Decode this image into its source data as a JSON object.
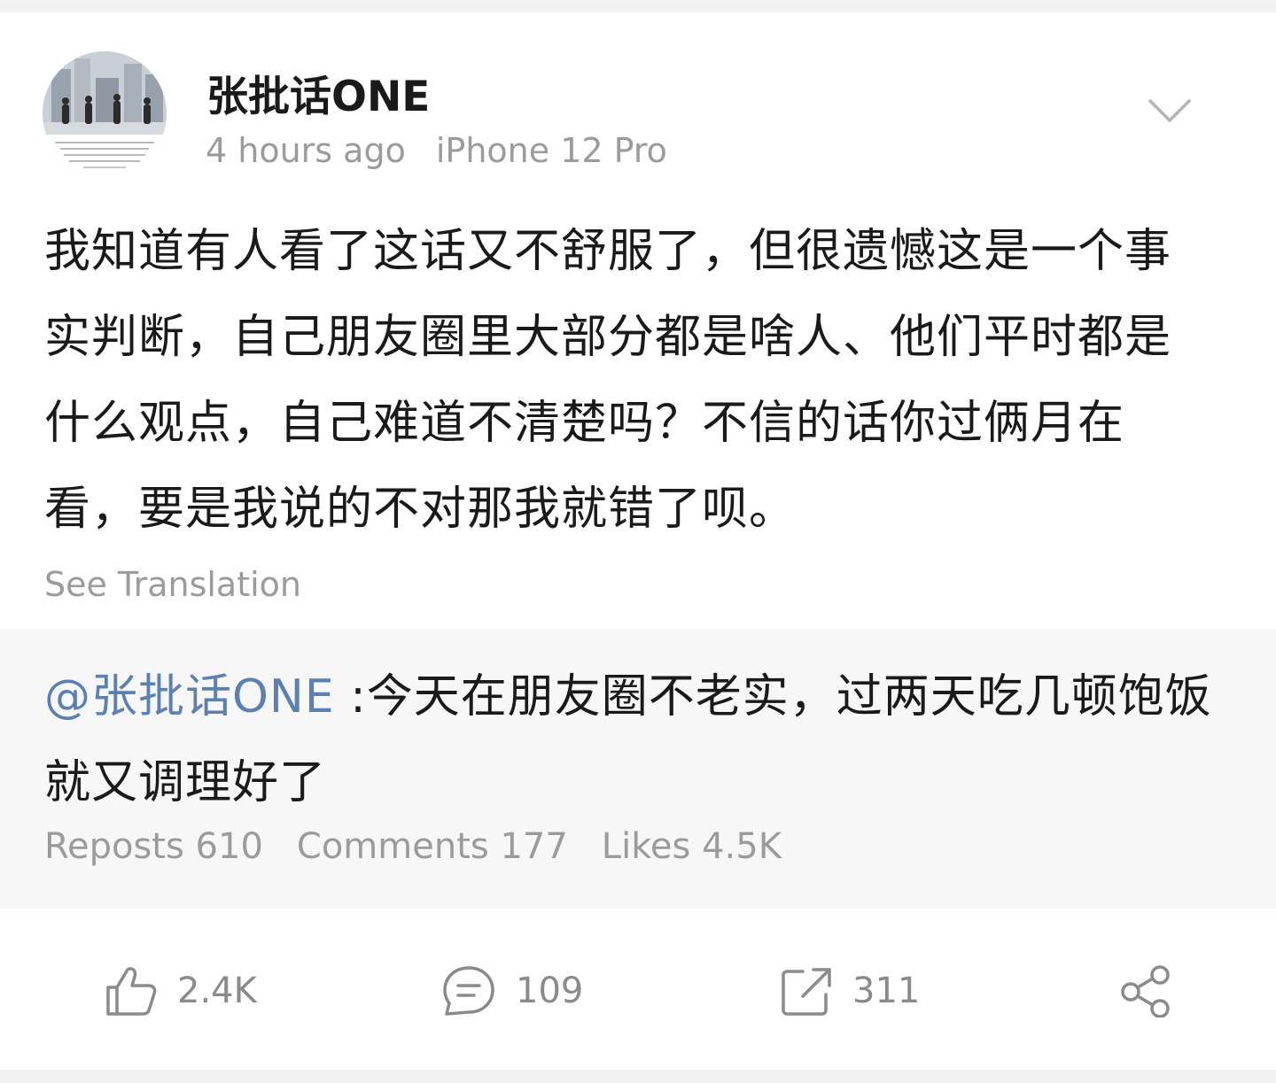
{
  "post": {
    "author": "张批话ONE",
    "time": "4 hours ago",
    "device": "iPhone 12 Pro",
    "text": "我知道有人看了这话又不舒服了，但很遗憾这是一个事实判断，自己朋友圈里大部分都是啥人、他们平时都是什么观点，自己难道不清楚吗？不信的话你过俩月在看，要是我说的不对那我就错了呗。",
    "translate_label": "See Translation",
    "menu_icon": "chevron-down-icon"
  },
  "repost": {
    "mention": "@张批话ONE",
    "text": " :今天在朋友圈不老实，过两天吃几顿饱饭就又调理好了",
    "reposts": "Reposts 610",
    "comments": "Comments 177",
    "likes": "Likes 4.5K"
  },
  "actions": {
    "like_count": "2.4K",
    "comment_count": "109",
    "repost_count": "311",
    "share_icon": "share-icon"
  },
  "colors": {
    "mention": "#5b80b2",
    "muted": "#9b9b9b",
    "repost_bg": "#f7f7f7"
  }
}
